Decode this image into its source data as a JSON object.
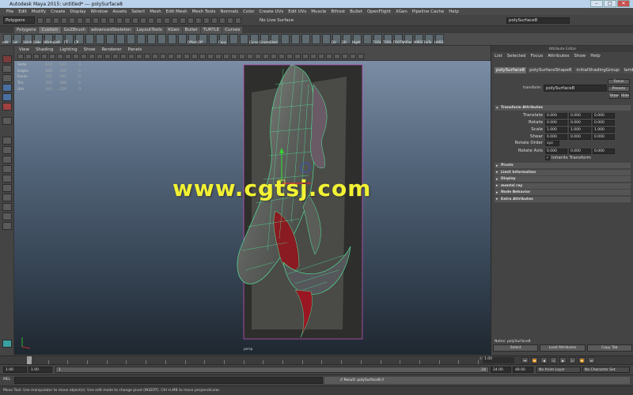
{
  "window": {
    "title": "Autodesk Maya 2015: untitled*   ---   polySurface8"
  },
  "menubar": {
    "items": [
      "File",
      "Edit",
      "Modify",
      "Create",
      "Display",
      "Window",
      "Assets",
      "Select",
      "Mesh",
      "Edit Mesh",
      "Mesh Tools",
      "Normals",
      "Color",
      "Create UVs",
      "Edit UVs",
      "Muscle",
      "Bifrost",
      "Bullet",
      "OpenFlight",
      "XGen",
      "Pipeline Cache",
      "Help"
    ]
  },
  "statusline": {
    "menuset": "Polygons",
    "live_surface": "No Live Surface",
    "field_value": "polySurface8"
  },
  "shelf_tabs": [
    "Polygons",
    "Custom",
    "GoZBrush",
    "advancedSkeleton",
    "LayoutTools",
    "XGen",
    "Bullet",
    "TURTLE",
    "Curves"
  ],
  "shelf_active_index": 1,
  "shelf_buttons": [
    "edit",
    "Sel",
    "Stitch",
    "Slide",
    "NOrms",
    "Soft",
    "FT",
    "CP",
    "",
    "",
    "",
    "",
    "",
    "",
    "",
    "",
    "",
    "",
    "Offset",
    "Off",
    "",
    "Copy",
    "",
    "",
    "Curve",
    "Groom",
    "Blast",
    "",
    "",
    "",
    "",
    "",
    "DV",
    "DR",
    "Night",
    "",
    "TOOL",
    "TOOL",
    "FROTN",
    "AFter",
    "MIRSF",
    "ReTe",
    "HARD"
  ],
  "panel": {
    "menu": [
      "View",
      "Shading",
      "Lighting",
      "Show",
      "Renderer",
      "Panels"
    ],
    "label": "persp"
  },
  "hud": {
    "rows": [
      {
        "label": "Verts",
        "a": "674",
        "b": "147",
        "c": "0"
      },
      {
        "label": "Edges",
        "a": "898",
        "b": "345",
        "c": "0"
      },
      {
        "label": "Faces",
        "a": "322",
        "b": "161",
        "c": "0"
      },
      {
        "label": "Tris",
        "a": "320",
        "b": "288",
        "c": "0"
      },
      {
        "label": "UVs",
        "a": "443",
        "b": "229",
        "c": "0"
      }
    ]
  },
  "watermark": "www.cgtsj.com",
  "attribute_editor": {
    "title": "Attribute Editor",
    "menu": [
      "List",
      "Selected",
      "Focus",
      "Attributes",
      "Show",
      "Help"
    ],
    "tabs": [
      "polySurface8",
      "polySurfaceShape8",
      "initialShadingGroup",
      "lambert2"
    ],
    "active_tab": 0,
    "transform_label": "transform:",
    "transform_value": "polySurface8",
    "focus_label": "Focus",
    "presets_label": "Presets",
    "show_label": "Show",
    "hide_label": "Hide",
    "section_transform": "Transform Attributes",
    "attrs": [
      {
        "label": "Translate",
        "v": [
          "0.000",
          "0.000",
          "0.000"
        ]
      },
      {
        "label": "Rotate",
        "v": [
          "0.000",
          "0.000",
          "0.000"
        ]
      },
      {
        "label": "Scale",
        "v": [
          "1.000",
          "1.000",
          "1.000"
        ]
      },
      {
        "label": "Shear",
        "v": [
          "0.000",
          "0.000",
          "0.000"
        ]
      }
    ],
    "rotate_order_label": "Rotate Order",
    "rotate_order_value": "xyz",
    "rotate_axis_label": "Rotate Axis",
    "rotate_axis": [
      "0.000",
      "0.000",
      "0.000"
    ],
    "inherits_label": "Inherits Transform",
    "sections": [
      "Pivots",
      "Limit Information",
      "Display",
      "mental ray",
      "Node Behavior",
      "Extra Attributes"
    ],
    "notes_label": "Notes: polySurface8",
    "bottom_buttons": [
      "Select",
      "Load Attributes",
      "Copy Tab"
    ]
  },
  "timeline": {
    "labels": [
      "1",
      "",
      "",
      "",
      "",
      "",
      "",
      "",
      "",
      "",
      "",
      "",
      "",
      "",
      "",
      "",
      "",
      "",
      "",
      "",
      "",
      "",
      "",
      "24"
    ],
    "current_frame": "1.00",
    "start": "1.00",
    "inner_start": "1.00",
    "range_start": "1",
    "range_end": "24",
    "end": "24.00",
    "end2": "48.00",
    "anim_layer": "No Anim Layer",
    "char_set": "No Character Set"
  },
  "cmdline": {
    "label": "MEL",
    "result": "// Result: polySurface8 //"
  },
  "helpline": {
    "text": "Move Tool: Use manipulator to move object(s). Use edit mode to change pivot (INSERT). Ctrl+LMB to move perpendicular."
  },
  "colors": {
    "wire": "#55f0a0",
    "selection": "#c052c0",
    "accent": "#5285a6",
    "watermark": "#f2f234"
  }
}
